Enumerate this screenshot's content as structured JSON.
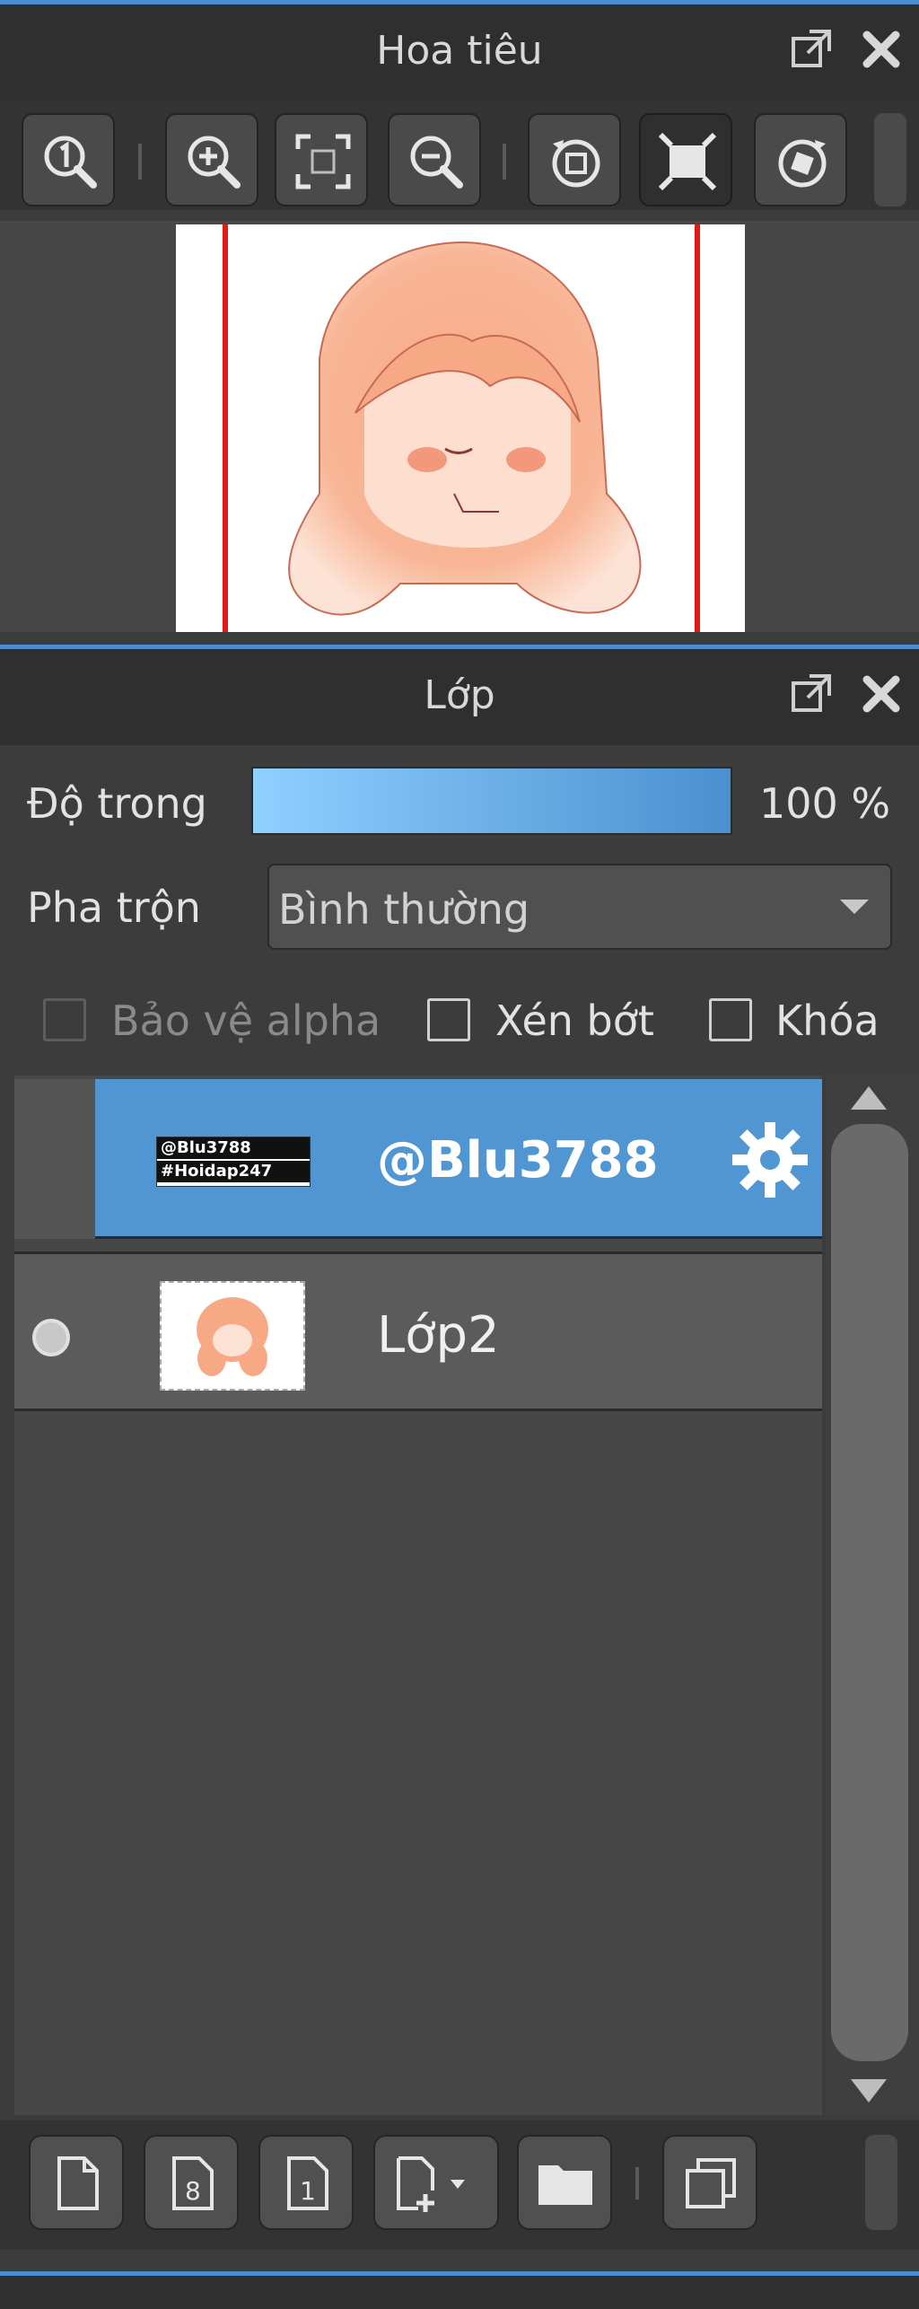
{
  "navigator": {
    "title": "Hoa tiêu",
    "icons": [
      "popout-icon",
      "close-icon",
      "zoom-actual-icon",
      "zoom-in-icon",
      "fit-screen-icon",
      "zoom-out-icon",
      "rotate-left-icon",
      "fullscreen-icon",
      "rotate-right-icon"
    ]
  },
  "layers_panel": {
    "title": "Lớp",
    "opacity_label": "Độ trong",
    "opacity_value": "100 %",
    "opacity_percent": 100,
    "blend_label": "Pha trộn",
    "blend_value": "Bình thường",
    "protect_alpha_label": "Bảo vệ alpha",
    "clip_label": "Xén bớt",
    "lock_label": "Khóa",
    "layers": [
      {
        "name": "@Blu3788",
        "thumb_text_1": "@Blu3788",
        "thumb_text_2": "#Hoidap247",
        "selected": true
      },
      {
        "name": "Lớp2",
        "selected": false
      }
    ],
    "accent_color": "#4f96d3",
    "bottom_icons": [
      "new-layer-icon",
      "new-8bit-layer-icon",
      "new-1bit-layer-icon",
      "add-layer-menu-icon",
      "folder-icon",
      "duplicate-layer-icon"
    ]
  }
}
